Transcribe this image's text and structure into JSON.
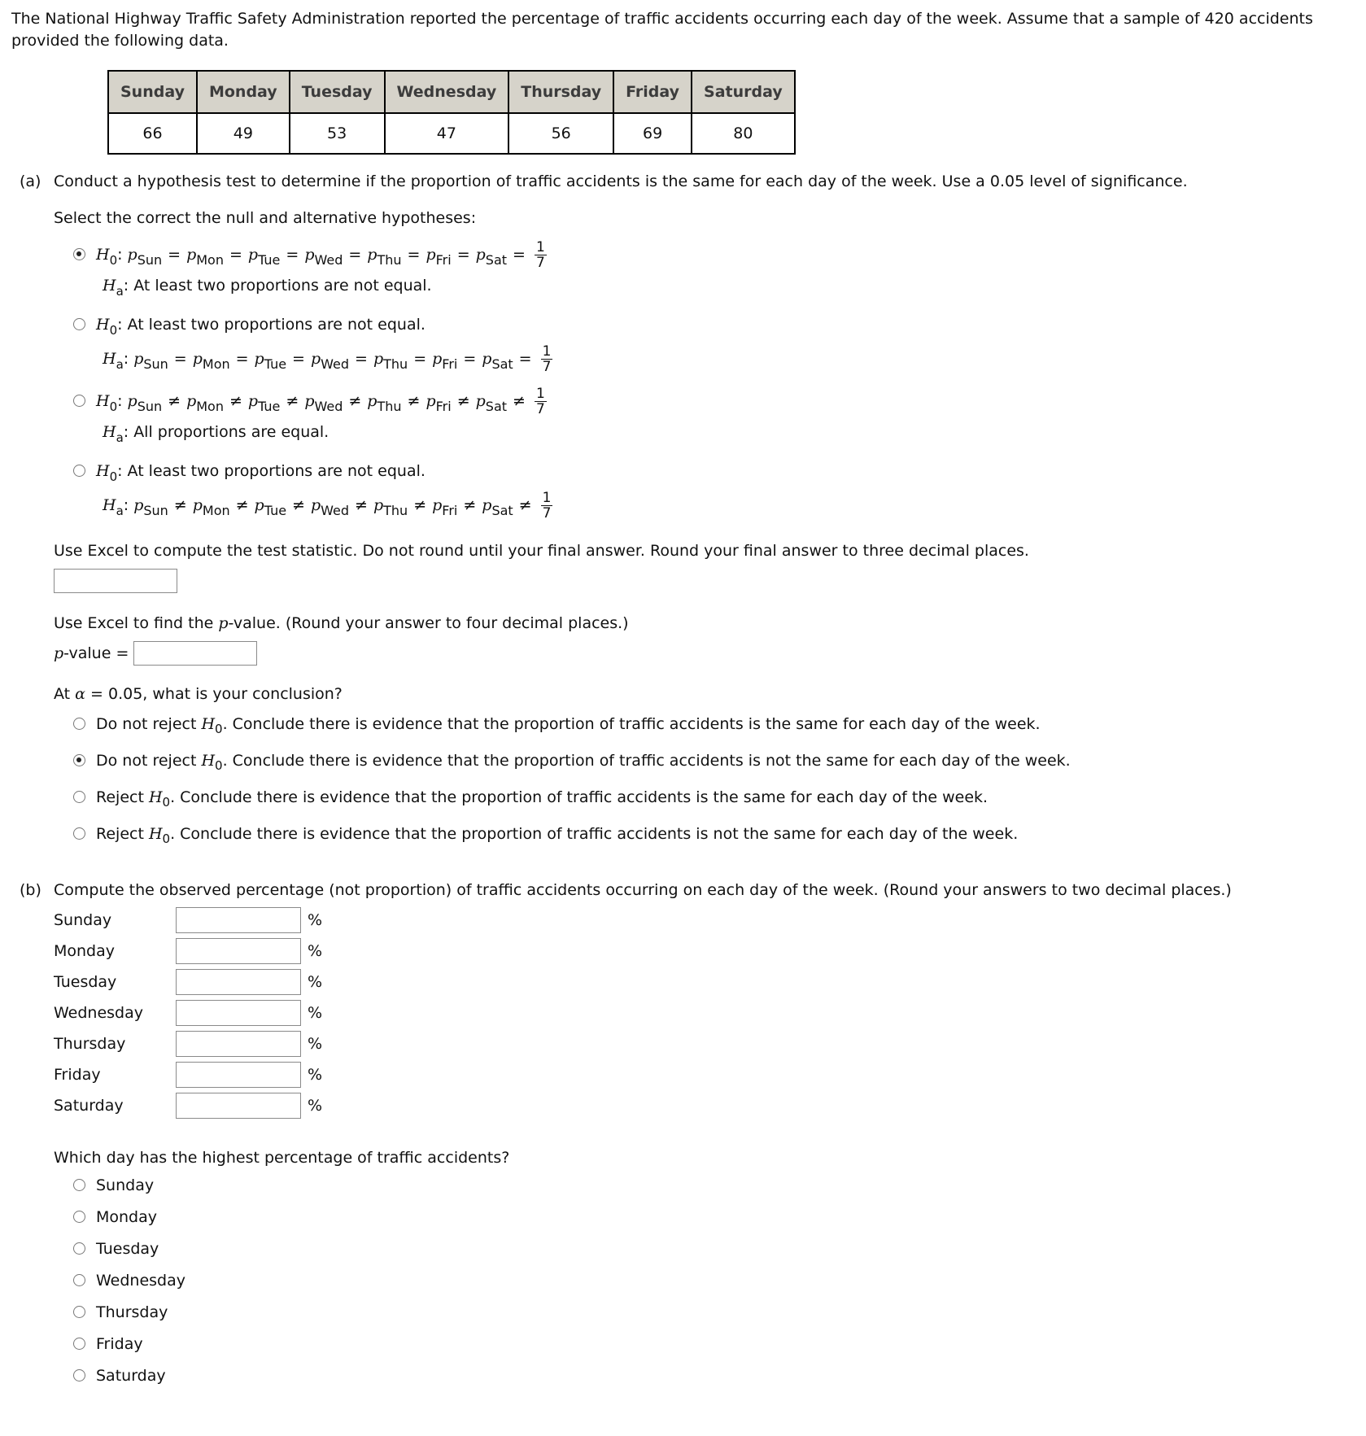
{
  "intro": "The National Highway Traffic Safety Administration reported the percentage of traffic accidents occurring each day of the week. Assume that a sample of 420 accidents provided the following data.",
  "table": {
    "headers": [
      "Sunday",
      "Monday",
      "Tuesday",
      "Wednesday",
      "Thursday",
      "Friday",
      "Saturday"
    ],
    "values": [
      "66",
      "49",
      "53",
      "47",
      "56",
      "69",
      "80"
    ]
  },
  "part_a": {
    "label": "(a)",
    "prompt": "Conduct a hypothesis test to determine if the proportion of traffic accidents is the same for each day of the week. Use a 0.05 level of significance.",
    "hyp_prompt": "Select the correct the null and alternative hypotheses:",
    "symbols": {
      "H": "H",
      "null_sub": "0",
      "alt_sub": "a",
      "p": "p",
      "colon": ":",
      "days": [
        "Sun",
        "Mon",
        "Tue",
        "Wed",
        "Thu",
        "Fri",
        "Sat"
      ],
      "eq": "=",
      "neq": "≠",
      "frac_num": "1",
      "frac_den": "7"
    },
    "hypotheses": [
      {
        "selected": true,
        "h0": "all-equal",
        "ha_text": "At least two proportions are not equal."
      },
      {
        "selected": false,
        "h0_text": "At least two proportions are not equal.",
        "ha": "all-equal"
      },
      {
        "selected": false,
        "h0": "all-not-equal",
        "ha_text": "All proportions are equal."
      },
      {
        "selected": false,
        "h0_text": "At least two proportions are not equal.",
        "ha": "all-not-equal"
      }
    ],
    "test_stat_prompt": "Use Excel to compute the test statistic. Do not round until your final answer. Round your final answer to three decimal places.",
    "test_stat_value": "",
    "pvalue_prompt_pre": "Use Excel to find the ",
    "pvalue_prompt_p": "p",
    "pvalue_prompt_post": "-value. (Round your answer to four decimal places.)",
    "pvalue_label_p": "p",
    "pvalue_label_rest": "-value =",
    "pvalue_value": "",
    "conclusion_prompt_pre": "At ",
    "alpha": "α",
    "conclusion_prompt_post": " = 0.05, what is your conclusion?",
    "conclusions": [
      {
        "pre": "Do not reject ",
        "post": ". Conclude there is evidence that the proportion of traffic accidents is the same for each day of the week.",
        "selected": false
      },
      {
        "pre": "Do not reject ",
        "post": ". Conclude there is evidence that the proportion of traffic accidents is not the same for each day of the week.",
        "selected": true
      },
      {
        "pre": "Reject ",
        "post": ". Conclude there is evidence that the proportion of traffic accidents is the same for each day of the week.",
        "selected": false
      },
      {
        "pre": "Reject ",
        "post": ". Conclude there is evidence that the proportion of traffic accidents is not the same for each day of the week.",
        "selected": false
      }
    ]
  },
  "part_b": {
    "label": "(b)",
    "prompt": "Compute the observed percentage (not proportion) of traffic accidents occurring on each day of the week. (Round your answers to two decimal places.)",
    "rows": [
      {
        "day": "Sunday",
        "value": "",
        "unit": "%"
      },
      {
        "day": "Monday",
        "value": "",
        "unit": "%"
      },
      {
        "day": "Tuesday",
        "value": "",
        "unit": "%"
      },
      {
        "day": "Wednesday",
        "value": "",
        "unit": "%"
      },
      {
        "day": "Thursday",
        "value": "",
        "unit": "%"
      },
      {
        "day": "Friday",
        "value": "",
        "unit": "%"
      },
      {
        "day": "Saturday",
        "value": "",
        "unit": "%"
      }
    ],
    "highest_prompt": "Which day has the highest percentage of traffic accidents?",
    "highest_options": [
      {
        "label": "Sunday",
        "selected": false
      },
      {
        "label": "Monday",
        "selected": false
      },
      {
        "label": "Tuesday",
        "selected": false
      },
      {
        "label": "Wednesday",
        "selected": false
      },
      {
        "label": "Thursday",
        "selected": false
      },
      {
        "label": "Friday",
        "selected": false
      },
      {
        "label": "Saturday",
        "selected": false
      }
    ]
  }
}
